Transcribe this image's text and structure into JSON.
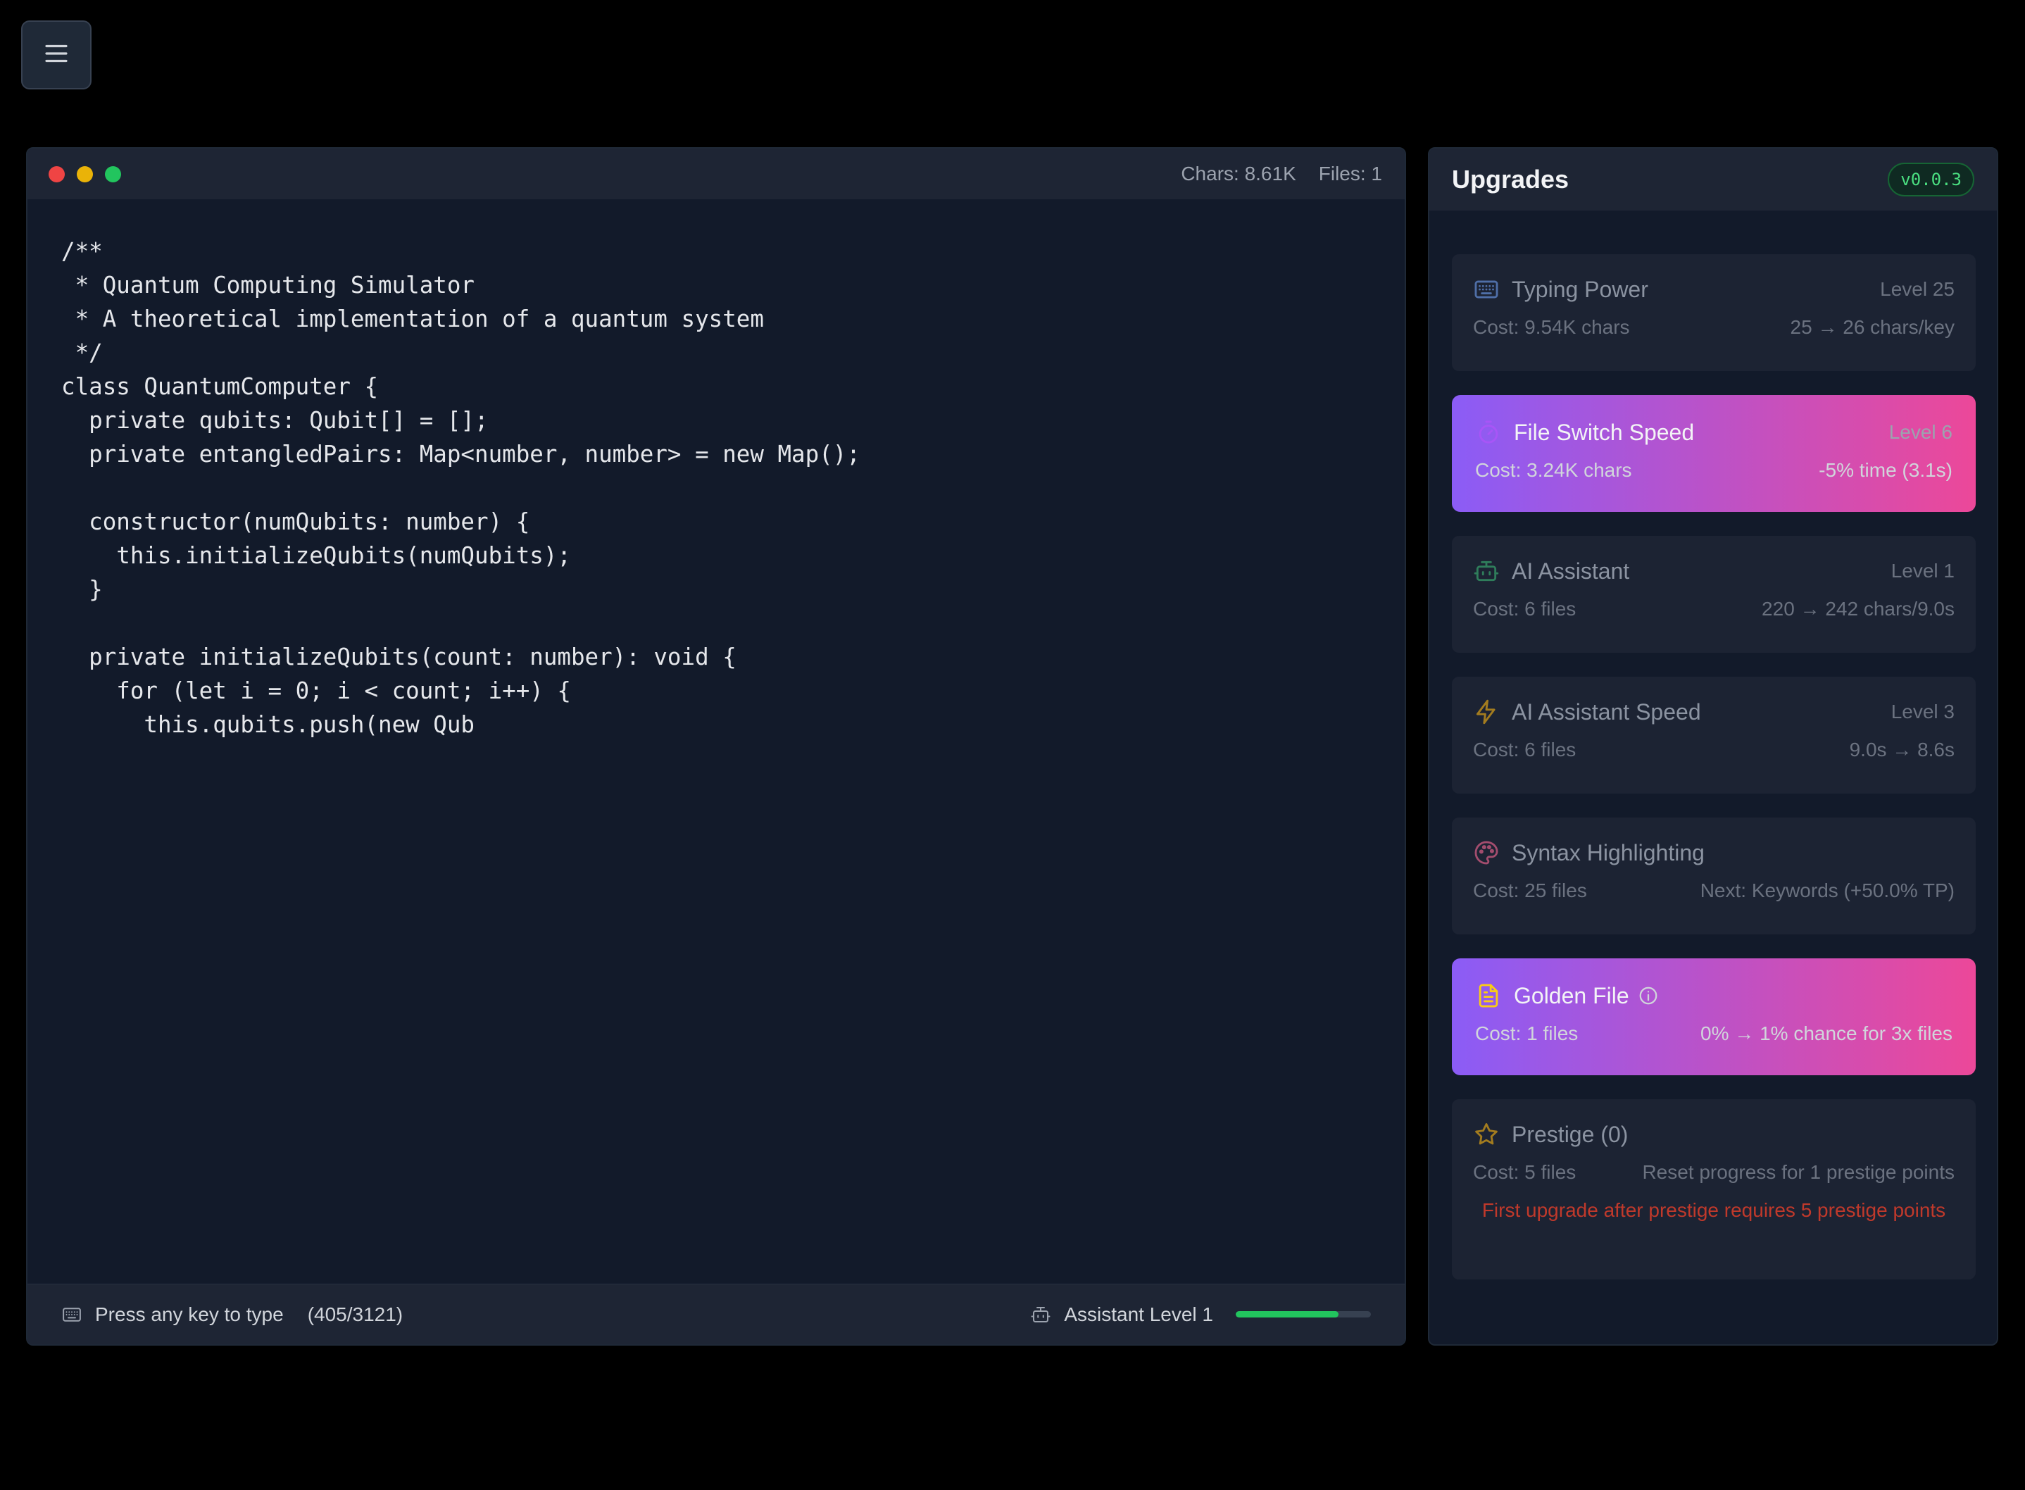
{
  "menu": {
    "icon": "hamburger-menu-icon"
  },
  "editor": {
    "stats": {
      "chars": "Chars: 8.61K",
      "files": "Files: 1"
    },
    "code_lines": [
      "/**",
      " * Quantum Computing Simulator",
      " * A theoretical implementation of a quantum system",
      " */",
      "class QuantumComputer {",
      "  private qubits: Qubit[] = [];",
      "  private entangledPairs: Map<number, number> = new Map();",
      "",
      "  constructor(numQubits: number) {",
      "    this.initializeQubits(numQubits);",
      "  }",
      "",
      "  private initializeQubits(count: number): void {",
      "    for (let i = 0; i < count; i++) {",
      "      this.qubits.push(new Qub"
    ],
    "status": {
      "hint": "Press any key to type",
      "progress_count": "(405/3121)",
      "assistant_label": "Assistant Level 1",
      "assistant_progress": 0.76
    }
  },
  "upgrades": {
    "title": "Upgrades",
    "version": "v0.0.3",
    "items": [
      {
        "icon": "keyboard-icon",
        "name": "Typing Power",
        "level": "Level 25",
        "cost": "Cost: 9.54K chars",
        "effect": "25 → 26 chars/key",
        "state": "dim",
        "icon_color": "#4f6fa8"
      },
      {
        "icon": "stopwatch-icon",
        "name": "File Switch Speed",
        "level": "Level 6",
        "cost": "Cost: 3.24K chars",
        "effect": "-5% time (3.1s)",
        "state": "active",
        "icon_color": "#a855f7"
      },
      {
        "icon": "robot-icon",
        "name": "AI Assistant",
        "level": "Level 1",
        "cost": "Cost: 6 files",
        "effect": "220 → 242 chars/9.0s",
        "state": "dim",
        "icon_color": "#2f7d5b"
      },
      {
        "icon": "lightning-icon",
        "name": "AI Assistant Speed",
        "level": "Level 3",
        "cost": "Cost: 6 files",
        "effect": "9.0s → 8.6s",
        "state": "dim",
        "icon_color": "#a37c1f"
      },
      {
        "icon": "palette-icon",
        "name": "Syntax Highlighting",
        "level": "",
        "cost": "Cost: 25 files",
        "effect": "Next: Keywords (+50.0% TP)",
        "state": "dim",
        "icon_color": "#a34d6e"
      },
      {
        "icon": "document-icon",
        "name": "Golden File",
        "level": "",
        "cost": "Cost: 1 files",
        "effect": "0% → 1% chance for 3x files",
        "state": "golden",
        "icon_color": "#facc15"
      },
      {
        "icon": "star-icon",
        "name": "Prestige (0)",
        "level": "",
        "cost": "Cost: 5 files",
        "effect": "Reset progress for 1 prestige points",
        "state": "dim",
        "icon_color": "#a37c1f",
        "warning": "First upgrade after prestige requires 5 prestige points"
      }
    ]
  }
}
